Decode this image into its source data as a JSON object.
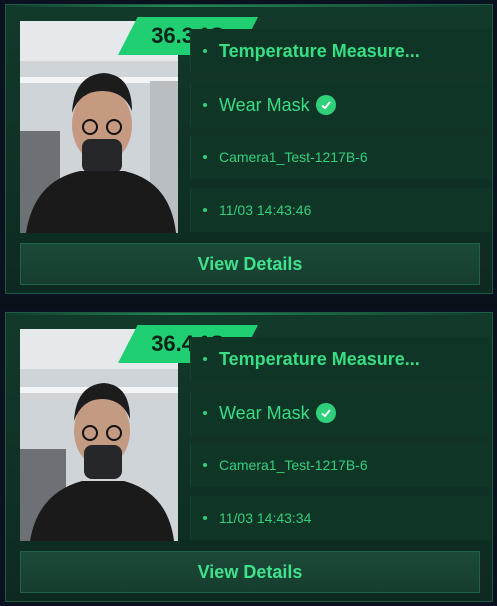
{
  "records": [
    {
      "temperature": "36.3 °C",
      "title": "Temperature Measure...",
      "mask_status": "Wear Mask",
      "camera": "Camera1_Test-1217B-6",
      "time": "11/03 14:43:46",
      "details_label": "View Details"
    },
    {
      "temperature": "36.4 °C",
      "title": "Temperature Measure...",
      "mask_status": "Wear Mask",
      "camera": "Camera1_Test-1217B-6",
      "time": "11/03 14:43:34",
      "details_label": "View Details"
    }
  ],
  "colors": {
    "accent": "#2fd07a",
    "card_bg": "#123a2b",
    "page_bg": "#0a1220"
  },
  "icons": {
    "mask_ok": "check-circle-icon",
    "bullet": "dot-icon"
  }
}
